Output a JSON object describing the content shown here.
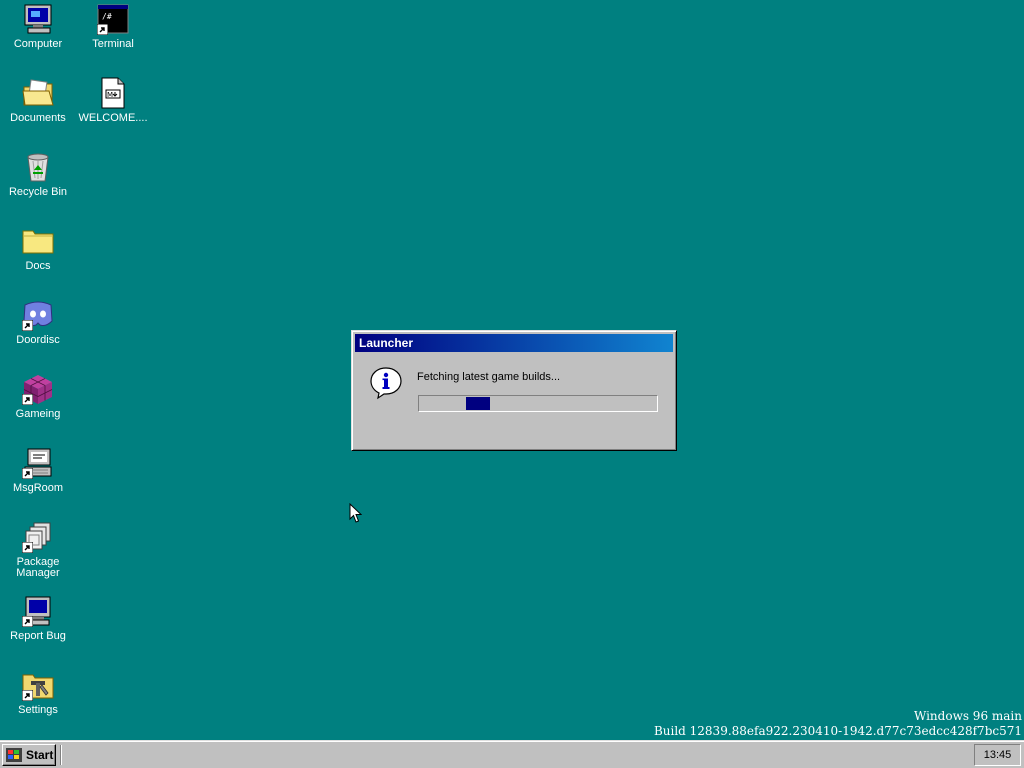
{
  "desktop": {
    "background": "#008080",
    "icons": [
      {
        "label": "Computer",
        "icon": "computer-icon"
      },
      {
        "label": "Terminal",
        "icon": "terminal-icon"
      },
      {
        "label": "Documents",
        "icon": "documents-folder-icon"
      },
      {
        "label": "WELCOME....",
        "icon": "markdown-file-icon"
      },
      {
        "label": "Recycle Bin",
        "icon": "recycle-bin-icon"
      },
      {
        "label": "Docs",
        "icon": "folder-icon"
      },
      {
        "label": "Doordisc",
        "icon": "doordisc-icon"
      },
      {
        "label": "Gameing",
        "icon": "gameing-cube-icon"
      },
      {
        "label": "MsgRoom",
        "icon": "msgroom-icon"
      },
      {
        "label": "Package Manager",
        "icon": "package-manager-icon"
      },
      {
        "label": "Report Bug",
        "icon": "report-bug-icon"
      },
      {
        "label": "Settings",
        "icon": "settings-icon"
      }
    ]
  },
  "dialog": {
    "title": "Launcher",
    "message": "Fetching latest game builds...",
    "icon": "info-icon",
    "progress_style": "marquee"
  },
  "build_info": {
    "line1": "Windows 96 main",
    "line2": "Build 12839.88efa922.230410-1942.d77c73edcc428f7bc571"
  },
  "taskbar": {
    "start_label": "Start",
    "clock": "13:45"
  },
  "colors": {
    "desktop": "#008080",
    "face": "#c0c0c0",
    "titlebar_start": "#000080",
    "titlebar_end": "#1084d0",
    "progress_block": "#000080"
  }
}
